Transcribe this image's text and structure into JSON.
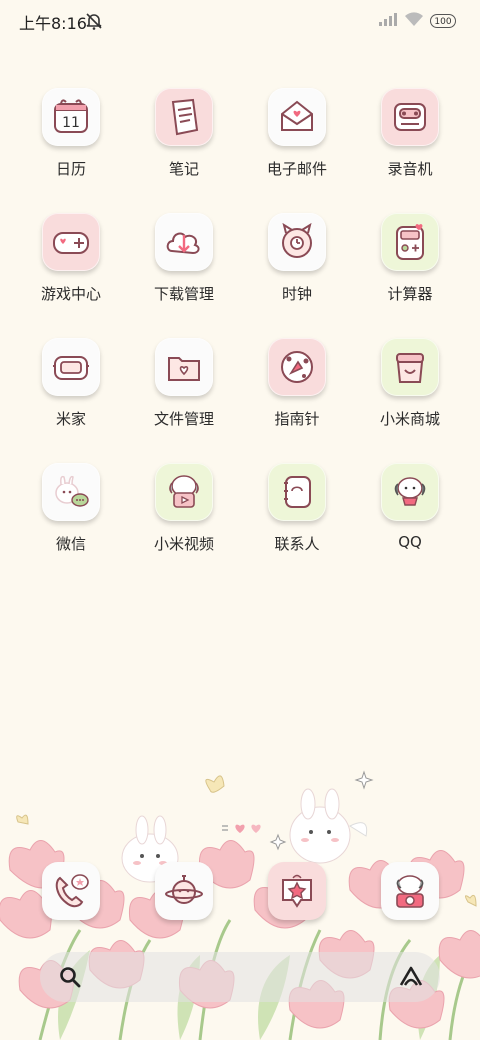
{
  "status_bar": {
    "time": "上午8:16",
    "battery": "100",
    "icons": [
      "mute-bell-icon",
      "signal-icon",
      "wifi-icon",
      "battery-icon"
    ]
  },
  "apps": [
    {
      "label": "日历",
      "icon": "calendar-icon",
      "bg": "white",
      "badge_text": "11"
    },
    {
      "label": "笔记",
      "icon": "notes-icon",
      "bg": "pink"
    },
    {
      "label": "电子邮件",
      "icon": "mail-icon",
      "bg": "white"
    },
    {
      "label": "录音机",
      "icon": "recorder-icon",
      "bg": "pink"
    },
    {
      "label": "游戏中心",
      "icon": "gamepad-icon",
      "bg": "pink"
    },
    {
      "label": "下载管理",
      "icon": "download-icon",
      "bg": "white"
    },
    {
      "label": "时钟",
      "icon": "clock-icon",
      "bg": "white"
    },
    {
      "label": "计算器",
      "icon": "calculator-icon",
      "bg": "green"
    },
    {
      "label": "米家",
      "icon": "mijia-icon",
      "bg": "white"
    },
    {
      "label": "文件管理",
      "icon": "folder-icon",
      "bg": "white"
    },
    {
      "label": "指南针",
      "icon": "compass-icon",
      "bg": "pink"
    },
    {
      "label": "小米商城",
      "icon": "shop-icon",
      "bg": "green"
    },
    {
      "label": "微信",
      "icon": "wechat-icon",
      "bg": "white"
    },
    {
      "label": "小米视频",
      "icon": "video-icon",
      "bg": "green"
    },
    {
      "label": "联系人",
      "icon": "contacts-icon",
      "bg": "green"
    },
    {
      "label": "QQ",
      "icon": "qq-icon",
      "bg": "green"
    }
  ],
  "dock": [
    {
      "icon": "phone-icon",
      "bg": "white"
    },
    {
      "icon": "browser-icon",
      "bg": "white"
    },
    {
      "icon": "messages-icon",
      "bg": "pink"
    },
    {
      "icon": "camera-icon",
      "bg": "white"
    }
  ],
  "colors": {
    "background": "#fdf9ef",
    "icon_line": "#8a4a55",
    "accent_pink": "#f2a0ad",
    "tulip_pink": "#f6c2c6",
    "leaf_green": "#b9d79a"
  }
}
